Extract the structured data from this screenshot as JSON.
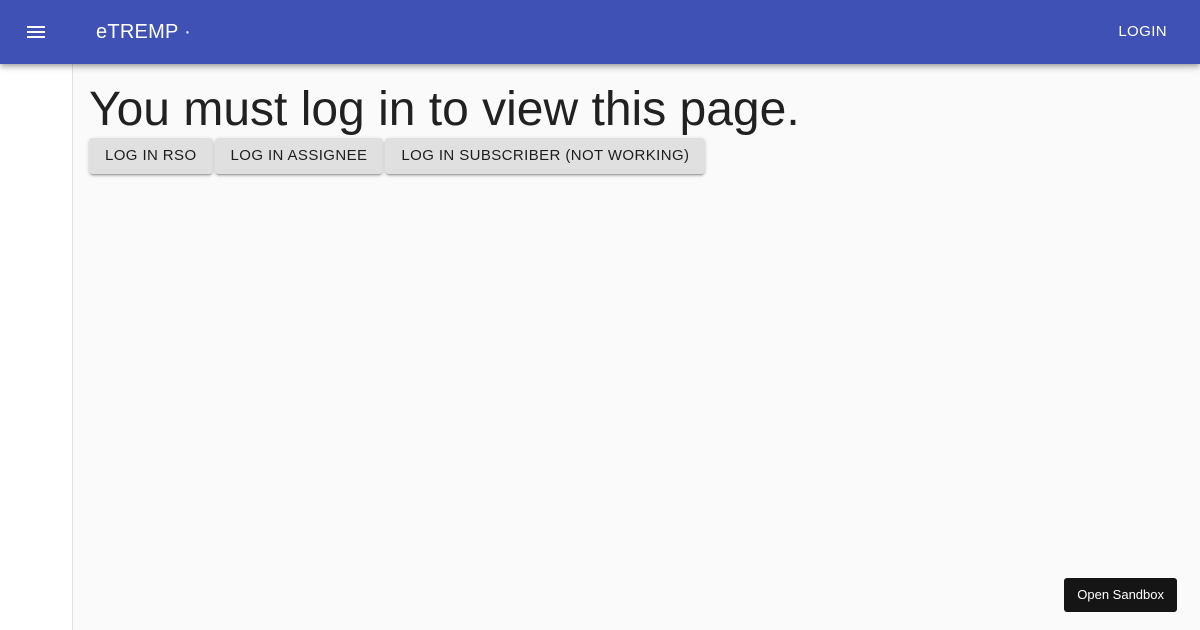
{
  "appbar": {
    "menu_icon": "menu-icon",
    "title": "eTREMP ·",
    "login_label": "LOGIN"
  },
  "main": {
    "heading": "You must log in to view this page.",
    "buttons": [
      {
        "label": "LOG IN RSO"
      },
      {
        "label": "LOG IN ASSIGNEE"
      },
      {
        "label": "LOG IN SUBSCRIBER (NOT WORKING)"
      }
    ]
  },
  "sandbox": {
    "label": "Open Sandbox"
  },
  "colors": {
    "appbar_bg": "#3f51b5",
    "button_bg": "#e0e0e0",
    "page_bg": "#fafafa",
    "sandbox_bg": "#151515"
  }
}
